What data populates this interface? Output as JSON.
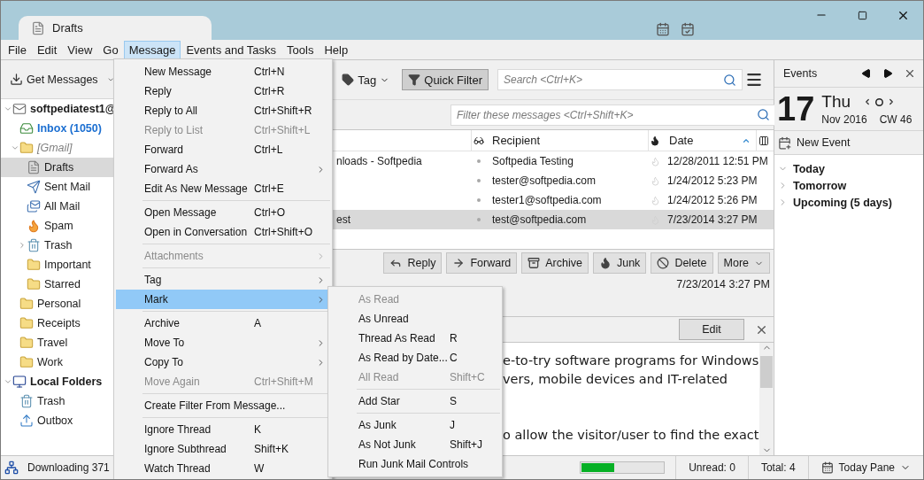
{
  "tabs": [
    {
      "label": "Drafts",
      "selected": true
    }
  ],
  "menu_bar": [
    {
      "label": "File",
      "selected": false
    },
    {
      "label": "Edit",
      "selected": false
    },
    {
      "label": "View",
      "selected": false
    },
    {
      "label": "Go",
      "selected": false
    },
    {
      "label": "Message",
      "selected": true
    },
    {
      "label": "Events and Tasks",
      "selected": false
    },
    {
      "label": "Tools",
      "selected": false
    },
    {
      "label": "Help",
      "selected": false
    }
  ],
  "message_menu": {
    "sections": [
      {
        "items": [
          {
            "label": "New Message",
            "shortcut": "Ctrl+N",
            "disabled": false,
            "has_submenu": false,
            "selected": false
          },
          {
            "label": "Reply",
            "shortcut": "Ctrl+R",
            "disabled": false,
            "has_submenu": false,
            "selected": false
          },
          {
            "label": "Reply to All",
            "shortcut": "Ctrl+Shift+R",
            "disabled": false,
            "has_submenu": false,
            "selected": false
          },
          {
            "label": "Reply to List",
            "shortcut": "Ctrl+Shift+L",
            "disabled": true,
            "has_submenu": false,
            "selected": false
          },
          {
            "label": "Forward",
            "shortcut": "Ctrl+L",
            "disabled": false,
            "has_submenu": false,
            "selected": false
          },
          {
            "label": "Forward As",
            "disabled": false,
            "has_submenu": true,
            "selected": false
          },
          {
            "label": "Edit As New Message",
            "shortcut": "Ctrl+E",
            "disabled": false,
            "has_submenu": false,
            "selected": false
          }
        ]
      },
      {
        "items": [
          {
            "label": "Open Message",
            "shortcut": "Ctrl+O",
            "disabled": false,
            "has_submenu": false,
            "selected": false
          },
          {
            "label": "Open in Conversation",
            "shortcut": "Ctrl+Shift+O",
            "disabled": false,
            "has_submenu": false,
            "selected": false
          }
        ]
      },
      {
        "items": [
          {
            "label": "Attachments",
            "disabled": true,
            "has_submenu": true,
            "selected": false
          }
        ]
      },
      {
        "items": [
          {
            "label": "Tag",
            "disabled": false,
            "has_submenu": true,
            "selected": false
          },
          {
            "label": "Mark",
            "disabled": false,
            "has_submenu": true,
            "selected": true
          }
        ]
      },
      {
        "items": [
          {
            "label": "Archive",
            "shortcut": "A",
            "disabled": false,
            "has_submenu": false,
            "selected": false
          },
          {
            "label": "Move To",
            "disabled": false,
            "has_submenu": true,
            "selected": false
          },
          {
            "label": "Copy To",
            "disabled": false,
            "has_submenu": true,
            "selected": false
          },
          {
            "label": "Move Again",
            "shortcut": "Ctrl+Shift+M",
            "disabled": true,
            "has_submenu": false,
            "selected": false
          }
        ]
      },
      {
        "items": [
          {
            "label": "Create Filter From Message...",
            "disabled": false,
            "has_submenu": false,
            "selected": false
          }
        ]
      },
      {
        "items": [
          {
            "label": "Ignore Thread",
            "shortcut": "K",
            "disabled": false,
            "has_submenu": false,
            "selected": false
          },
          {
            "label": "Ignore Subthread",
            "shortcut": "Shift+K",
            "disabled": false,
            "has_submenu": false,
            "selected": false
          },
          {
            "label": "Watch Thread",
            "shortcut": "W",
            "disabled": false,
            "has_submenu": false,
            "selected": false
          }
        ]
      }
    ]
  },
  "mark_menu": {
    "sections": [
      {
        "items": [
          {
            "label": "As Read",
            "disabled": true,
            "selected": false
          },
          {
            "label": "As Unread",
            "disabled": false,
            "selected": false
          },
          {
            "label": "Thread As Read",
            "shortcut": "R",
            "disabled": false,
            "selected": false
          },
          {
            "label": "As Read by Date...",
            "shortcut": "C",
            "disabled": false,
            "selected": false
          },
          {
            "label": "All Read",
            "shortcut": "Shift+C",
            "disabled": true,
            "selected": false
          }
        ]
      },
      {
        "items": [
          {
            "label": "Add Star",
            "shortcut": "S",
            "disabled": false,
            "selected": false
          }
        ]
      },
      {
        "items": [
          {
            "label": "As Junk",
            "shortcut": "J",
            "disabled": false,
            "selected": false
          },
          {
            "label": "As Not Junk",
            "shortcut": "Shift+J",
            "disabled": false,
            "selected": false
          },
          {
            "label": "Run Junk Mail Controls",
            "disabled": false,
            "selected": false
          }
        ]
      }
    ]
  },
  "toolbar": {
    "get_messages": "Get Messages",
    "tag": "Tag",
    "quick_filter": {
      "label": "Quick Filter",
      "on": true
    },
    "search": {
      "placeholder": "Search <Ctrl+K>"
    }
  },
  "folders": [
    {
      "label": "softpediatest1@",
      "kind": "account",
      "expanded": true,
      "selected": false,
      "children": [
        {
          "label": "Inbox (1050)",
          "kind": "inbox",
          "selected": false
        },
        {
          "label": "[Gmail]",
          "kind": "virtual",
          "expanded": true,
          "selected": false,
          "children": [
            {
              "label": "Drafts",
              "kind": "drafts",
              "selected": true
            },
            {
              "label": "Sent Mail",
              "kind": "sent",
              "selected": false
            },
            {
              "label": "All Mail",
              "kind": "all",
              "selected": false
            },
            {
              "label": "Spam",
              "kind": "spam",
              "selected": false
            },
            {
              "label": "Trash",
              "kind": "trash",
              "expanded": false,
              "selected": false
            },
            {
              "label": "Important",
              "kind": "folder",
              "selected": false
            },
            {
              "label": "Starred",
              "kind": "folder",
              "selected": false
            }
          ]
        },
        {
          "label": "Personal",
          "kind": "folder",
          "selected": false
        },
        {
          "label": "Receipts",
          "kind": "folder",
          "selected": false
        },
        {
          "label": "Travel",
          "kind": "folder",
          "selected": false
        },
        {
          "label": "Work",
          "kind": "folder",
          "selected": false
        }
      ]
    },
    {
      "label": "Local Folders",
      "kind": "local",
      "expanded": true,
      "selected": false,
      "children": [
        {
          "label": "Trash",
          "kind": "trash",
          "selected": false
        },
        {
          "label": "Outbox",
          "kind": "outbox",
          "selected": false
        }
      ]
    }
  ],
  "filter": {
    "placeholder": "Filter these messages <Ctrl+Shift+K>"
  },
  "thread_list": {
    "columns": [
      {
        "label": "Recipient",
        "sorted": false
      },
      {
        "label": "Date",
        "sorted": true
      }
    ],
    "rows": [
      {
        "column_1": "nloads - Softpedia",
        "recipient": "Softpedia Testing",
        "date": "12/28/2011 12:51 PM",
        "selected": false
      },
      {
        "recipient": "tester@softpedia.com",
        "date": "1/24/2012 5:23 PM",
        "selected": false
      },
      {
        "recipient": "tester1@softpedia.com",
        "date": "1/24/2012 5:26 PM",
        "selected": false
      },
      {
        "column_1": "est",
        "recipient": "test@softpedia.com",
        "date": "7/23/2014 3:27 PM",
        "selected": true
      }
    ]
  },
  "message_header": {
    "buttons": [
      {
        "kind": "reply",
        "label": "Reply"
      },
      {
        "kind": "forward",
        "label": "Forward"
      },
      {
        "kind": "archive",
        "label": "Archive"
      },
      {
        "kind": "junk",
        "label": "Junk"
      },
      {
        "kind": "delete",
        "label": "Delete"
      },
      {
        "kind": "more",
        "label": "More"
      }
    ],
    "date": "7/23/2014 3:27 PM"
  },
  "notification": {
    "button": "Edit"
  },
  "body": {
    "paragraphs": [
      {
        "lines": [
          "e-to-try software programs for Windows",
          "vers, mobile devices and IT-related"
        ]
      },
      {
        "lines": [
          "o allow the visitor/user to find the exact"
        ]
      }
    ]
  },
  "events": {
    "title": "Events",
    "day": "17",
    "weekday": "Thu",
    "month_year": "Nov 2016",
    "week": "CW 46",
    "new_event": "New Event",
    "groups": [
      {
        "label": "Today",
        "expanded": true
      },
      {
        "label": "Tomorrow",
        "expanded": false
      },
      {
        "label": "Upcoming (5 days)",
        "expanded": false
      }
    ]
  },
  "status_bar": {
    "activity": "Downloading 371",
    "progress": {
      "level": 0.4
    },
    "unread": "Unread: 0",
    "total": "Total: 4",
    "today_pane": "Today Pane"
  }
}
